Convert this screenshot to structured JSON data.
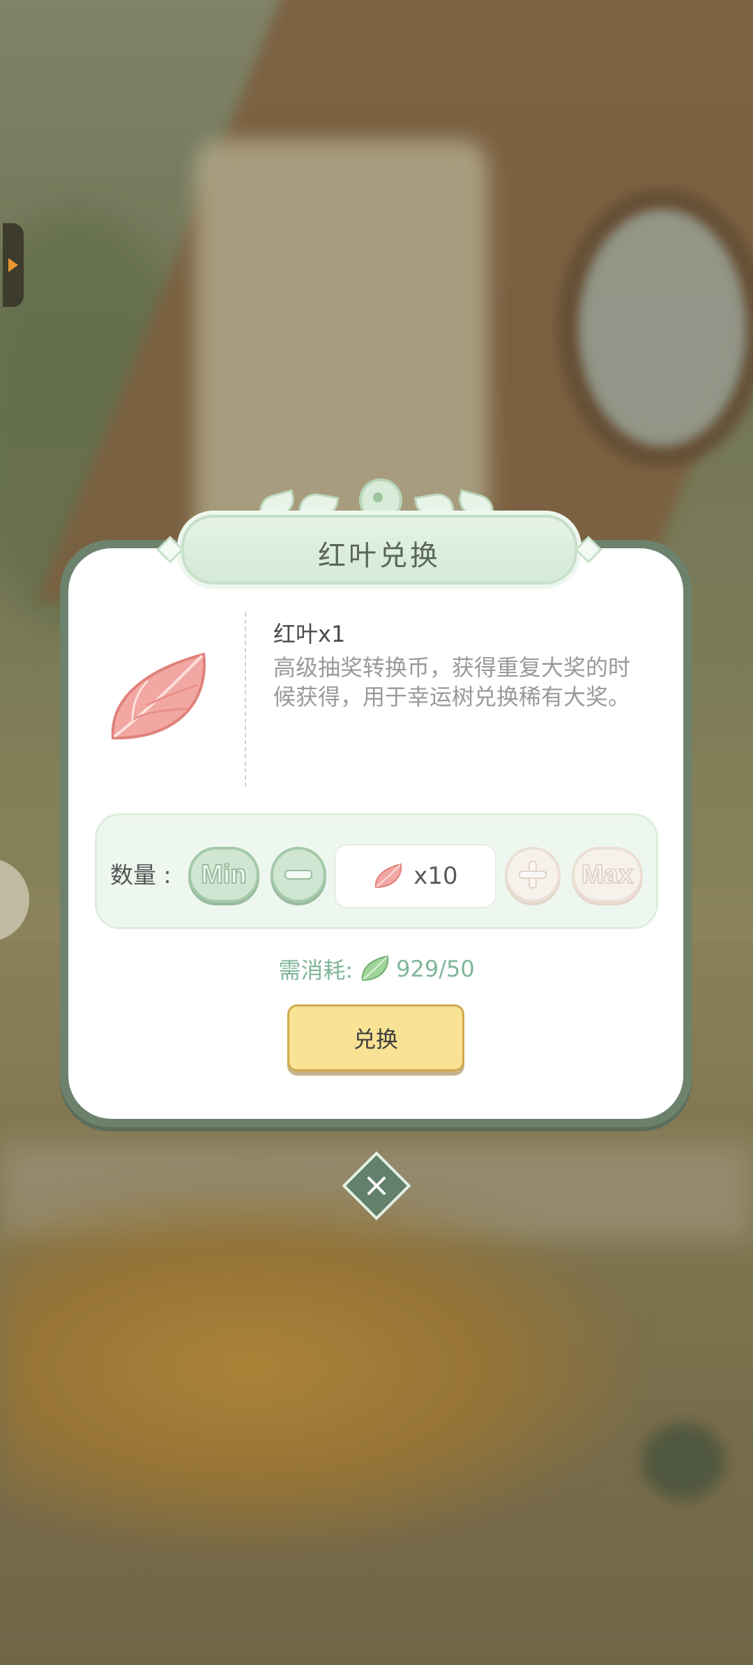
{
  "dialog": {
    "title": "红叶兑换",
    "item": {
      "name": "红叶x1",
      "description": "高级抽奖转换币，获得重复大奖的时候获得，用于幸运树兑换稀有大奖。",
      "icon": "red-leaf-icon"
    },
    "quantity": {
      "label": "数量 :",
      "min_label": "Min",
      "max_label": "Max",
      "value": "x10",
      "minus_icon": "minus-icon",
      "plus_icon": "plus-icon"
    },
    "cost": {
      "label": "需消耗:",
      "icon": "green-leaf-icon",
      "value": "929/50"
    },
    "confirm_label": "兑换",
    "close_icon": "close-icon"
  },
  "colors": {
    "frame": "#6d826d",
    "panel": "#eef7ef",
    "accent_green": "#7fb69a",
    "confirm": "#f9e294"
  }
}
